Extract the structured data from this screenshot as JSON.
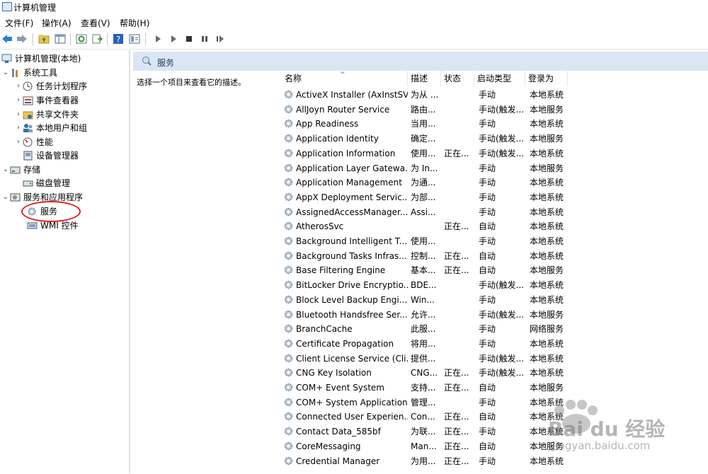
{
  "window": {
    "title": "计算机管理"
  },
  "menu": [
    "文件(F)",
    "操作(A)",
    "查看(V)",
    "帮助(H)"
  ],
  "toolbar": {
    "icons": [
      "back-arrow-icon",
      "forward-arrow-icon",
      "up-folder-icon",
      "show-hide-tree-icon",
      "refresh-icon",
      "export-list-icon",
      "help-icon",
      "properties-icon",
      "start-service-icon",
      "play-icon",
      "stop-icon",
      "pause-icon",
      "restart-icon"
    ]
  },
  "tree": {
    "root": "计算机管理(本地)",
    "system_tools": "系统工具",
    "task_scheduler": "任务计划程序",
    "event_viewer": "事件查看器",
    "shared_folders": "共享文件夹",
    "local_users": "本地用户和组",
    "performance": "性能",
    "device_manager": "设备管理器",
    "storage": "存储",
    "disk_management": "磁盘管理",
    "services_apps": "服务和应用程序",
    "services": "服务",
    "wmi": "WMI 控件"
  },
  "pane_title": "服务",
  "description_hint": "选择一个项目来查看它的描述。",
  "columns": {
    "name": "名称",
    "desc": "描述",
    "status": "状态",
    "startup": "启动类型",
    "logon": "登录为"
  },
  "services": [
    {
      "name": "ActiveX Installer (AxInstSV)",
      "desc": "为从 ...",
      "status": "",
      "startup": "手动",
      "logon": "本地系统"
    },
    {
      "name": "AllJoyn Router Service",
      "desc": "路由...",
      "status": "",
      "startup": "手动(触发...",
      "logon": "本地服务"
    },
    {
      "name": "App Readiness",
      "desc": "当用...",
      "status": "",
      "startup": "手动",
      "logon": "本地系统"
    },
    {
      "name": "Application Identity",
      "desc": "确定...",
      "status": "",
      "startup": "手动(触发...",
      "logon": "本地服务"
    },
    {
      "name": "Application Information",
      "desc": "使用...",
      "status": "正在...",
      "startup": "手动(触发...",
      "logon": "本地系统"
    },
    {
      "name": "Application Layer Gatewa...",
      "desc": "为 In...",
      "status": "",
      "startup": "手动",
      "logon": "本地服务"
    },
    {
      "name": "Application Management",
      "desc": "为通...",
      "status": "",
      "startup": "手动",
      "logon": "本地系统"
    },
    {
      "name": "AppX Deployment Servic...",
      "desc": "为部...",
      "status": "",
      "startup": "手动",
      "logon": "本地系统"
    },
    {
      "name": "AssignedAccessManager...",
      "desc": "Assi...",
      "status": "",
      "startup": "手动",
      "logon": "本地系统"
    },
    {
      "name": "AtherosSvc",
      "desc": "",
      "status": "正在...",
      "startup": "自动",
      "logon": "本地系统"
    },
    {
      "name": "Background Intelligent T...",
      "desc": "使用...",
      "status": "",
      "startup": "手动",
      "logon": "本地系统"
    },
    {
      "name": "Background Tasks Infras...",
      "desc": "控制...",
      "status": "正在...",
      "startup": "自动",
      "logon": "本地系统"
    },
    {
      "name": "Base Filtering Engine",
      "desc": "基本...",
      "status": "正在...",
      "startup": "自动",
      "logon": "本地服务"
    },
    {
      "name": "BitLocker Drive Encryptio...",
      "desc": "BDE...",
      "status": "",
      "startup": "手动(触发...",
      "logon": "本地系统"
    },
    {
      "name": "Block Level Backup Engi...",
      "desc": "Win...",
      "status": "",
      "startup": "手动",
      "logon": "本地系统"
    },
    {
      "name": "Bluetooth Handsfree Ser...",
      "desc": "允许...",
      "status": "",
      "startup": "手动(触发...",
      "logon": "本地服务"
    },
    {
      "name": "BranchCache",
      "desc": "此服...",
      "status": "",
      "startup": "手动",
      "logon": "网络服务"
    },
    {
      "name": "Certificate Propagation",
      "desc": "将用...",
      "status": "",
      "startup": "手动",
      "logon": "本地系统"
    },
    {
      "name": "Client License Service (Cli...",
      "desc": "提供...",
      "status": "",
      "startup": "手动(触发...",
      "logon": "本地系统"
    },
    {
      "name": "CNG Key Isolation",
      "desc": "CNG...",
      "status": "正在...",
      "startup": "手动(触发...",
      "logon": "本地系统"
    },
    {
      "name": "COM+ Event System",
      "desc": "支持...",
      "status": "正在...",
      "startup": "自动",
      "logon": "本地服务"
    },
    {
      "name": "COM+ System Application",
      "desc": "管理...",
      "status": "",
      "startup": "手动",
      "logon": "本地系统"
    },
    {
      "name": "Connected User Experien...",
      "desc": "Con...",
      "status": "正在...",
      "startup": "自动",
      "logon": "本地系统"
    },
    {
      "name": "Contact Data_585bf",
      "desc": "为联...",
      "status": "正在...",
      "startup": "手动",
      "logon": "本地系统"
    },
    {
      "name": "CoreMessaging",
      "desc": "Man...",
      "status": "正在...",
      "startup": "自动",
      "logon": "本地服务"
    },
    {
      "name": "Credential Manager",
      "desc": "为用...",
      "status": "正在...",
      "startup": "手动",
      "logon": "本地系统"
    }
  ],
  "watermark": {
    "brand": "Bai du 经验",
    "url": "jingyan.baidu.com"
  },
  "colors": {
    "header_band": "#dbe6f4",
    "circle": "#e0211f"
  }
}
